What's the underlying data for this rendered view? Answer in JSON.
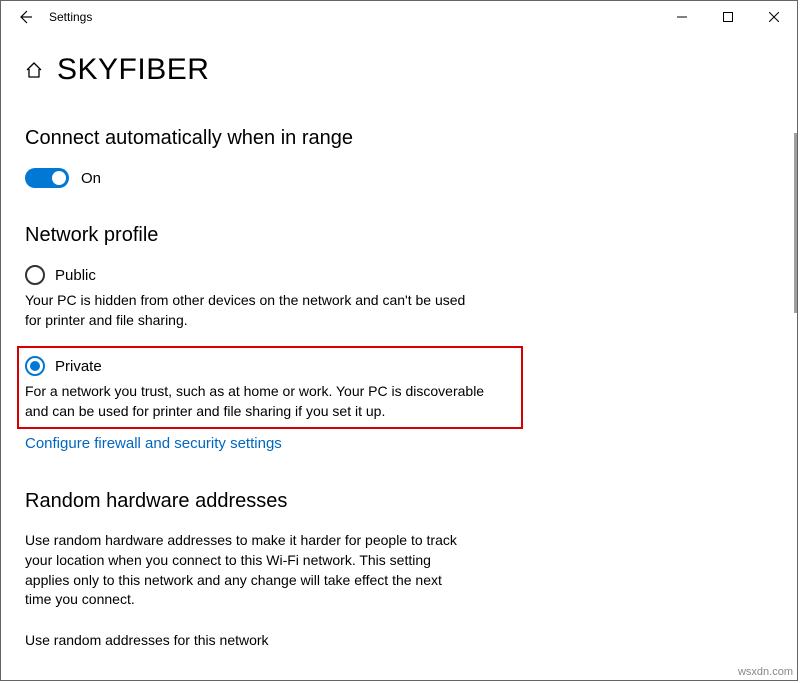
{
  "window": {
    "app_title": "Settings"
  },
  "page": {
    "title": "SKYFIBER"
  },
  "auto_connect": {
    "heading": "Connect automatically when in range",
    "state_label": "On"
  },
  "network_profile": {
    "heading": "Network profile",
    "public": {
      "label": "Public",
      "description": "Your PC is hidden from other devices on the network and can't be used for printer and file sharing."
    },
    "private": {
      "label": "Private",
      "description": "For a network you trust, such as at home or work. Your PC is discoverable and can be used for printer and file sharing if you set it up."
    },
    "configure_link": "Configure firewall and security settings"
  },
  "random_hw": {
    "heading": "Random hardware addresses",
    "description": "Use random hardware addresses to make it harder for people to track your location when you connect to this Wi-Fi network. This setting applies only to this network and any change will take effect the next time you connect.",
    "field_label": "Use random addresses for this network"
  },
  "watermark": "wsxdn.com"
}
